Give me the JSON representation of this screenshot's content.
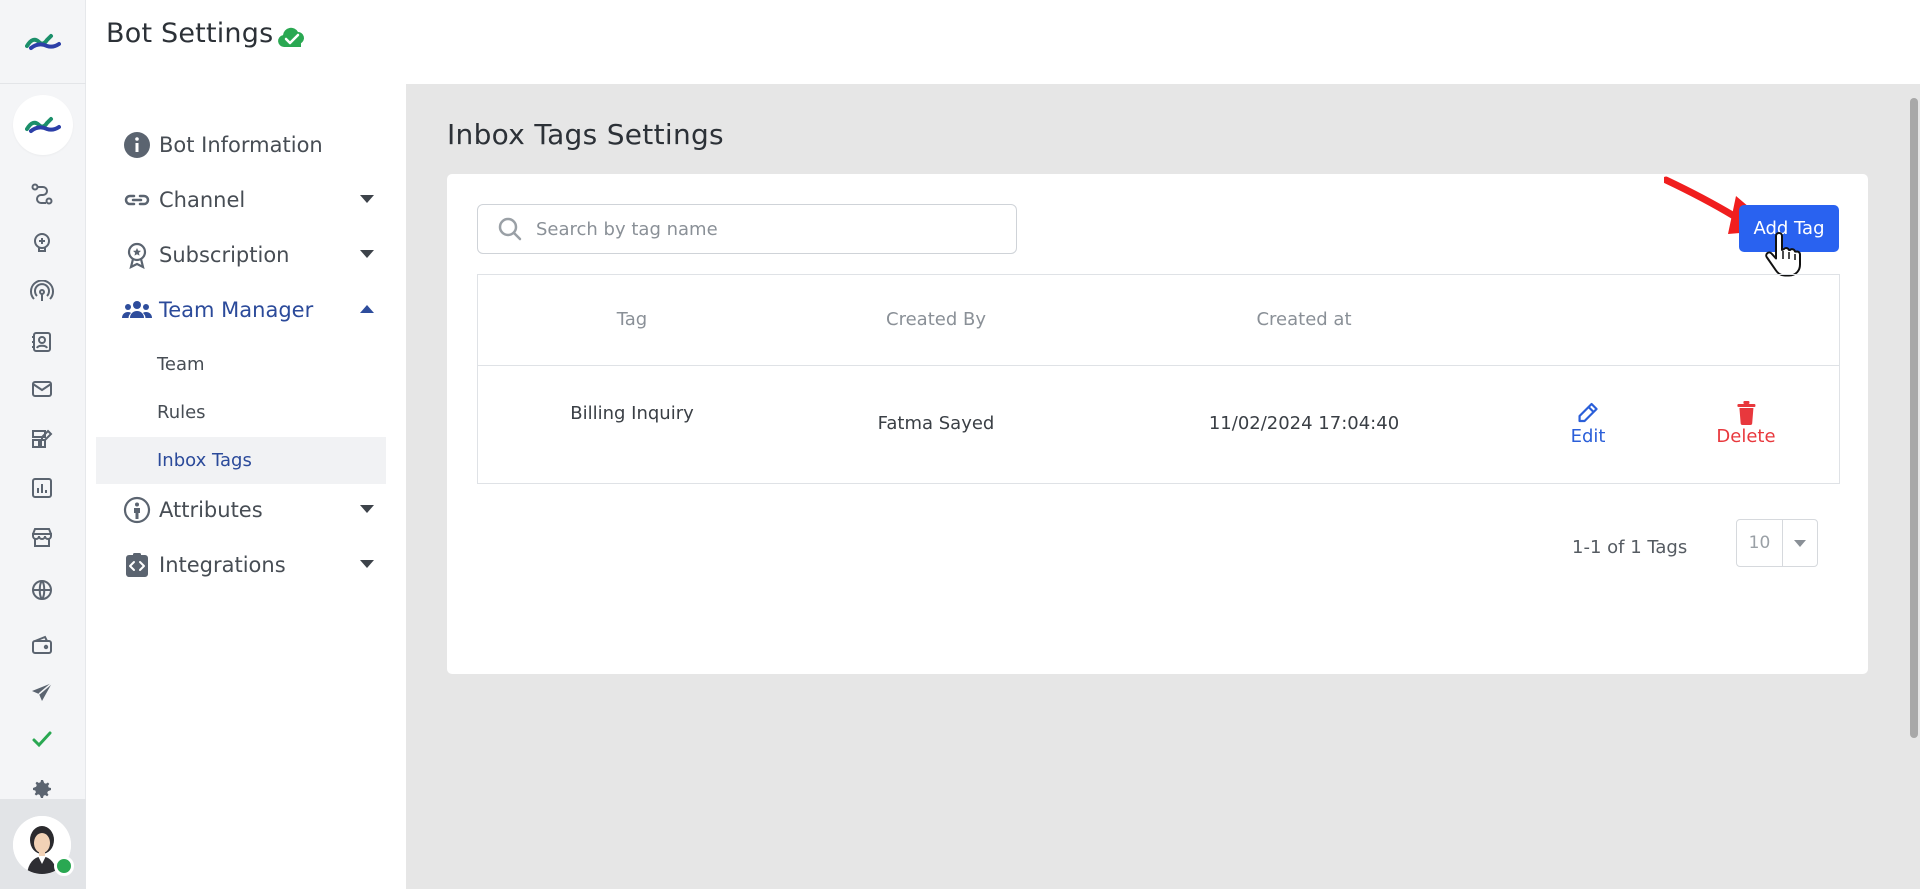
{
  "app": {
    "title": "Bot Settings",
    "status_icon": "cloud-check-icon"
  },
  "rail": {
    "icons": [
      "flow-icon",
      "bulb-icon",
      "broadcast-icon",
      "contacts-icon",
      "mail-icon",
      "builder-icon",
      "analytics-icon",
      "store-icon",
      "globe-icon",
      "wallet-icon",
      "send-icon",
      "check-icon",
      "gear-icon"
    ],
    "accent": "#2aa852"
  },
  "nav": {
    "items": [
      {
        "label": "Bot Information",
        "icon": "info-icon"
      },
      {
        "label": "Channel",
        "icon": "link-icon"
      },
      {
        "label": "Subscription",
        "icon": "badge-icon"
      },
      {
        "label": "Team Manager",
        "icon": "team-icon"
      },
      {
        "label": "Attributes",
        "icon": "person-icon"
      },
      {
        "label": "Integrations",
        "icon": "code-icon"
      }
    ],
    "team_sub": [
      {
        "label": "Team"
      },
      {
        "label": "Rules"
      },
      {
        "label": "Inbox Tags"
      }
    ]
  },
  "main": {
    "section_title": "Inbox Tags Settings",
    "search": {
      "placeholder": "Search by tag name",
      "value": ""
    },
    "add_button": "Add Tag",
    "table": {
      "headers": [
        "Tag",
        "Created By",
        "Created at"
      ],
      "rows": [
        {
          "tag": "Billing Inquiry",
          "created_by": "Fatma Sayed",
          "created_at": "11/02/2024 17:04:40",
          "edit_label": "Edit",
          "delete_label": "Delete"
        }
      ]
    },
    "pagination": {
      "summary": "1-1 of 1 Tags",
      "page_size": "10"
    }
  },
  "colors": {
    "primary": "#2962f0",
    "danger": "#e8383d",
    "link": "#2b5fd9",
    "nav_active": "#2b4a9a"
  }
}
